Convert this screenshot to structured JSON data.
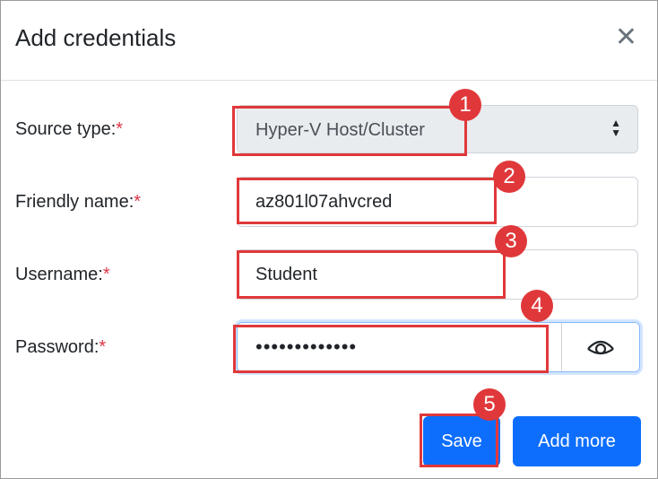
{
  "dialog": {
    "title": "Add credentials",
    "close_glyph": "✕"
  },
  "form": {
    "source_type": {
      "label": "Source type:",
      "required": "*",
      "value": "Hyper-V Host/Cluster"
    },
    "friendly_name": {
      "label": "Friendly name:",
      "required": "*",
      "value": "az801l07ahvcred"
    },
    "username": {
      "label": "Username:",
      "required": "*",
      "value": "Student"
    },
    "password": {
      "label": "Password:",
      "required": "*",
      "value": "•••••••••••••"
    }
  },
  "buttons": {
    "save": "Save",
    "add_more": "Add more"
  },
  "callouts": [
    "1",
    "2",
    "3",
    "4",
    "5"
  ],
  "colors": {
    "primary": "#0d6efd",
    "required": "#dc3545",
    "callout": "#e0383a"
  }
}
